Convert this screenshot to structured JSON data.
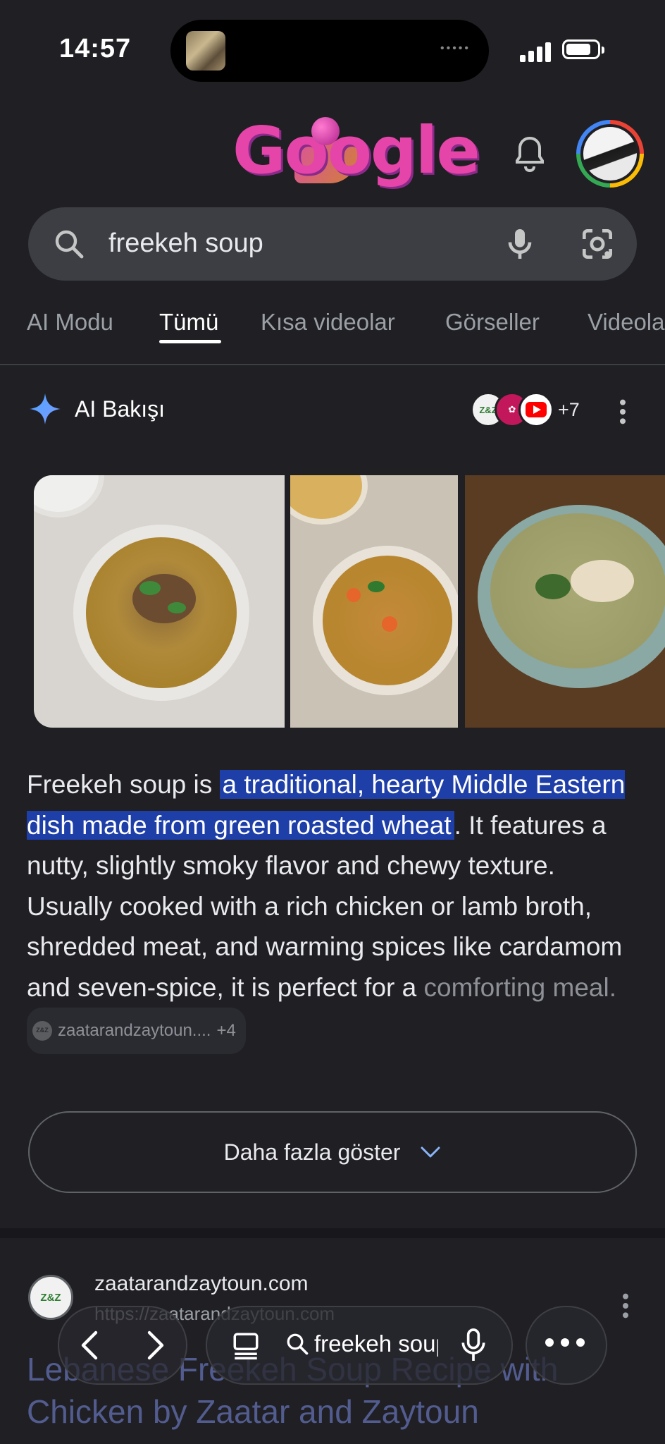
{
  "status_bar": {
    "time": "14:57",
    "island_dots": "•••••"
  },
  "header": {
    "logo_text": "Google",
    "icons": [
      "bell-icon",
      "avatar"
    ]
  },
  "search": {
    "query": "freekeh soup",
    "icons": [
      "search-icon",
      "mic-icon",
      "lens-icon"
    ]
  },
  "tabs": [
    {
      "label": "AI Modu",
      "active": false
    },
    {
      "label": "Tümü",
      "active": true
    },
    {
      "label": "Kısa videolar",
      "active": false
    },
    {
      "label": "Görseller",
      "active": false
    },
    {
      "label": "Videolar",
      "active": false
    }
  ],
  "ai_overview": {
    "title": "AI Bakışı",
    "source_count": "+7",
    "source_logo_1": "Z&Z",
    "text_before": "Freekeh soup is ",
    "text_highlight": "a traditional, hearty Middle Eastern dish made from green roasted wheat",
    "text_after": ". It features a nutty, slightly smoky flavor and chewy texture. Usually cooked with a rich chicken or lamb broth, shredded meat, and warming spices like cardamom and seven-spice, it is perfect for a ",
    "text_faded": "comforting meal.",
    "citation": {
      "logo": "Z&Z",
      "label": "zaatarandzaytoun....",
      "extra": "+4"
    },
    "show_more": "Daha fazla göster"
  },
  "result": {
    "favicon_text": "Z&Z",
    "domain": "zaatarandzaytoun.com",
    "url": "https://zaatarandzaytoun.com",
    "title": "Lebanese Freekeh Soup Recipe with Chicken by Zaatar and Zaytoun"
  },
  "toolbar": {
    "query": "freekeh soup",
    "icons": [
      "back-icon",
      "forward-icon",
      "tabs-icon",
      "search-icon",
      "mic-icon",
      "more-icon"
    ]
  },
  "colors": {
    "background": "#1f1f24",
    "search_bar": "#3c3e43",
    "highlight": "#1e3ea8",
    "link": "#7d8fe8"
  }
}
